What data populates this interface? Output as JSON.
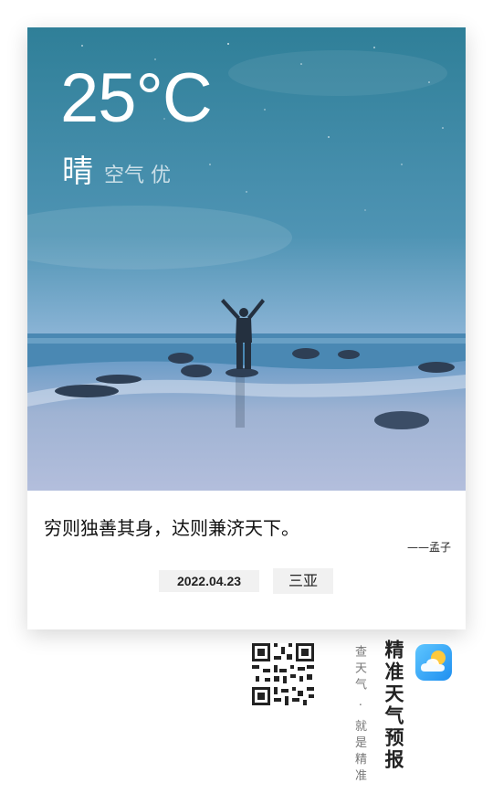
{
  "weather": {
    "temperature": "25°C",
    "condition": "晴",
    "air_quality": "空气 优"
  },
  "quote": {
    "text": "穷则独善其身，达则兼济天下。",
    "author": "——孟子"
  },
  "info": {
    "date": "2022.04.23",
    "city": "三亚"
  },
  "footer": {
    "slogan": "查天气 · 就是精准",
    "app_name": "精准天气预报",
    "app_icon": "sun-cloud-icon",
    "qr_icon": "qr-code-icon"
  },
  "colors": {
    "sky_top": "#2f7f98",
    "sky_bottom": "#8fb6d8",
    "sea": "#4a88b3",
    "beach": "#a8b9d6",
    "app_icon_bg": "#2a9af0"
  }
}
